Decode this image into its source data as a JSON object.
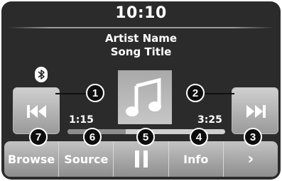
{
  "header": {
    "clock": "10:10"
  },
  "now_playing": {
    "artist": "Artist Name",
    "song": "Song Title",
    "elapsed": "1:15",
    "total": "3:25",
    "progress_fraction": 0.37
  },
  "icons": {
    "bluetooth": "bluetooth-icon",
    "previous": "skip-previous-icon",
    "next": "skip-next-icon",
    "album": "music-note-icon",
    "pause": "pause-icon"
  },
  "bottom_bar": {
    "browse": "Browse",
    "source": "Source",
    "info": "Info",
    "more": "›"
  },
  "callouts": [
    "1",
    "2",
    "3",
    "4",
    "5",
    "6",
    "7"
  ],
  "colors": {
    "screen_bg": "#2b2b2b",
    "button_light": "#c3c3c3",
    "callout_bg": "#0d0d0d"
  }
}
